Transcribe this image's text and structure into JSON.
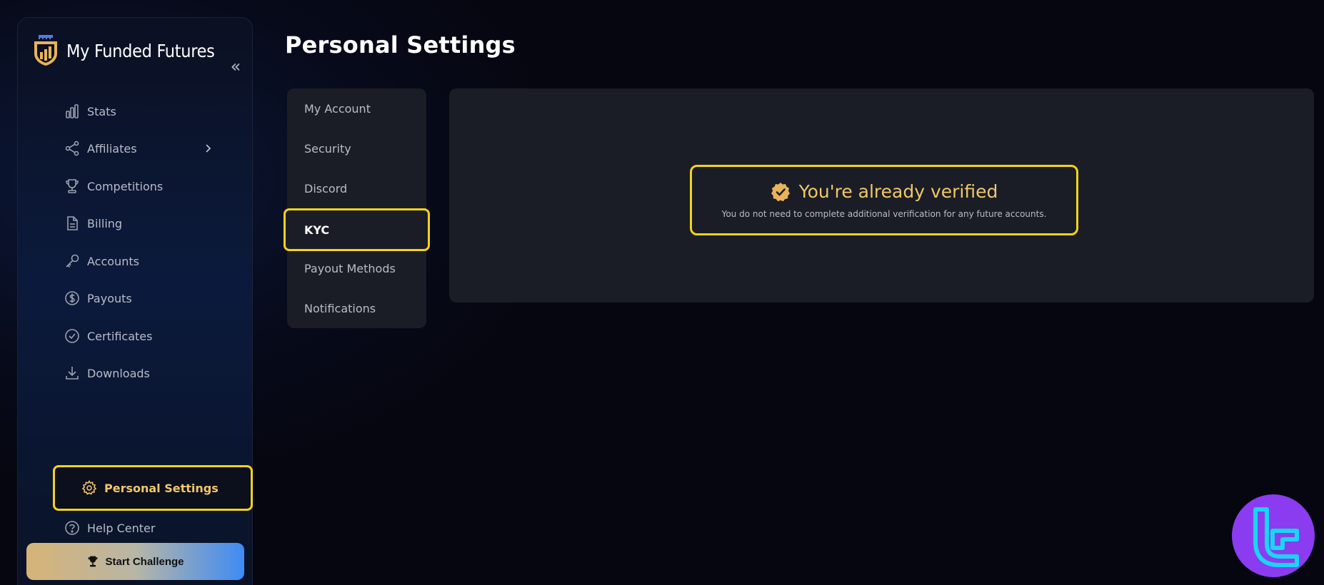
{
  "app": {
    "brand_name": "My Funded Futures",
    "collapse_glyph": "«"
  },
  "sidebar": {
    "items": [
      {
        "label": "Stats",
        "icon": "bar-chart-icon"
      },
      {
        "label": "Affiliates",
        "icon": "share-icon",
        "has_submenu": true
      },
      {
        "label": "Competitions",
        "icon": "trophy-icon"
      },
      {
        "label": "Billing",
        "icon": "document-icon"
      },
      {
        "label": "Accounts",
        "icon": "key-icon"
      },
      {
        "label": "Payouts",
        "icon": "dollar-icon"
      },
      {
        "label": "Certificates",
        "icon": "check-circle-icon"
      },
      {
        "label": "Downloads",
        "icon": "download-icon"
      },
      {
        "label": "Personal Settings",
        "icon": "gear-icon",
        "active": true
      },
      {
        "label": "Help Center",
        "icon": "help-icon"
      }
    ],
    "cta_label": "Start Challenge"
  },
  "main": {
    "title": "Personal Settings",
    "tabs": [
      {
        "label": "My Account"
      },
      {
        "label": "Security"
      },
      {
        "label": "Discord"
      },
      {
        "label": "KYC",
        "active": true
      },
      {
        "label": "Payout Methods"
      },
      {
        "label": "Notifications"
      }
    ],
    "kyc": {
      "title": "You're already verified",
      "description": "You do not need to complete additional verification for any future accounts."
    }
  },
  "colors": {
    "accent_gold": "#f0c76a",
    "highlight_yellow": "#f2d31c",
    "panel_bg": "#1b1d26",
    "corner_logo_purple": "#8b3cf0",
    "corner_logo_cyan": "#19d6f5"
  }
}
